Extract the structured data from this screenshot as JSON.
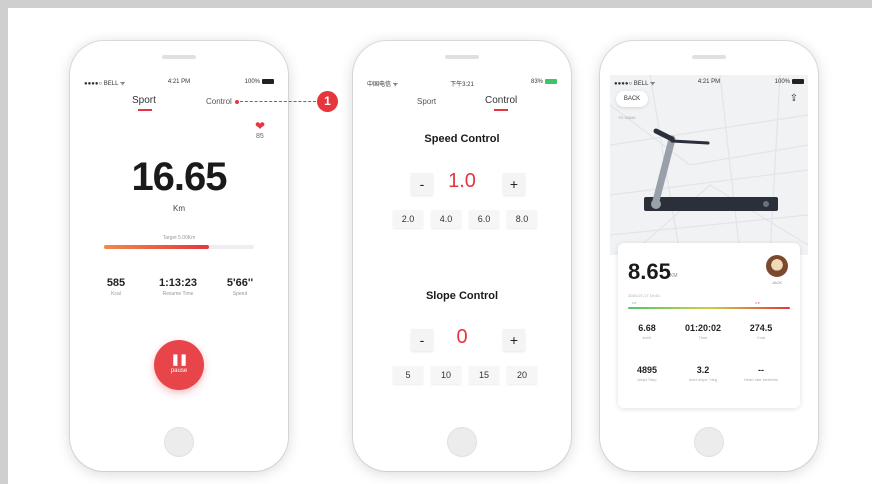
{
  "phone_sport": {
    "status": {
      "carrier": "●●●●○ BELL ᯤ",
      "time": "4:21 PM",
      "battery": "100%"
    },
    "tabs": [
      {
        "label": "Sport"
      },
      {
        "label": "Control"
      }
    ],
    "heart_rate": "85",
    "distance": "16.65",
    "unit": "Km",
    "target": "Target 5.00Km",
    "progress": 0.7,
    "stats": [
      {
        "value": "585",
        "label": "Kcal"
      },
      {
        "value": "1:13:23",
        "label": "Resume Time"
      },
      {
        "value": "5'66''",
        "label": "Speed"
      }
    ],
    "pause_label": "pause"
  },
  "callout_number": "1",
  "phone_control": {
    "status": {
      "carrier": "中国电信 ᯤ",
      "time": "下午3:21",
      "battery": "83%"
    },
    "tabs": [
      {
        "label": "Sport"
      },
      {
        "label": "Control"
      }
    ],
    "speed": {
      "title": "Speed Control",
      "minus": "-",
      "plus": "+",
      "value": "1.0",
      "presets": [
        "2.0",
        "4.0",
        "6.0",
        "8.0"
      ]
    },
    "slope": {
      "title": "Slope Control",
      "minus": "-",
      "plus": "+",
      "value": "0",
      "presets": [
        "5",
        "10",
        "15",
        "20"
      ]
    }
  },
  "phone_result": {
    "status": {
      "carrier": "●●●●○ BELL ᯤ",
      "time": "4:21 PM",
      "battery": "100%"
    },
    "back_label": "BACK",
    "map_label": "TS-30686",
    "distance": "8.65",
    "unit": "KM",
    "date": "2020-07-17 19:43",
    "user_name": "JACK",
    "bar_left": "0.8'",
    "bar_right": "2.6'",
    "stats": [
      {
        "value": "6.68",
        "label": "km/h"
      },
      {
        "value": "01:20:02",
        "label": "Time"
      },
      {
        "value": "274.5",
        "label": "Kcal"
      },
      {
        "value": "4895",
        "label": "steps Step"
      },
      {
        "value": "3.2",
        "label": "Aver slope °deg"
      },
      {
        "value": "--",
        "label": "Heart rate beat/min"
      }
    ]
  },
  "colors": {
    "accent": "#e6353d",
    "track": "#eeeeee"
  }
}
